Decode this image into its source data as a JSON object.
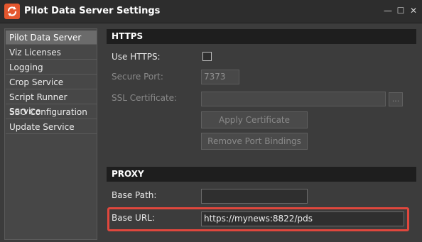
{
  "window": {
    "title": "Pilot Data Server Settings",
    "app_icon": "pilot-logo-icon",
    "controls": {
      "minimize": "—",
      "maximize": "☐",
      "close": "✕"
    }
  },
  "sidebar": {
    "items": [
      {
        "label": "Pilot Data Server",
        "active": true
      },
      {
        "label": "Viz Licenses",
        "active": false
      },
      {
        "label": "Logging",
        "active": false
      },
      {
        "label": "Crop Service",
        "active": false
      },
      {
        "label": "Script Runner Service",
        "active": false
      },
      {
        "label": "SSO Configuration",
        "active": false
      },
      {
        "label": "Update Service",
        "active": false
      }
    ]
  },
  "https": {
    "header": "HTTPS",
    "use_https_label": "Use HTTPS:",
    "use_https_checked": false,
    "secure_port_label": "Secure Port:",
    "secure_port_value": "7373",
    "ssl_certificate_label": "SSL Certificate:",
    "ssl_certificate_value": "",
    "browse_label": "...",
    "apply_certificate_label": "Apply Certificate",
    "remove_port_bindings_label": "Remove Port Bindings"
  },
  "proxy": {
    "header": "PROXY",
    "base_path_label": "Base Path:",
    "base_path_value": "",
    "base_url_label": "Base URL:",
    "base_url_value": "https://mynews:8822/pds",
    "highlight_color": "#e0473d"
  }
}
